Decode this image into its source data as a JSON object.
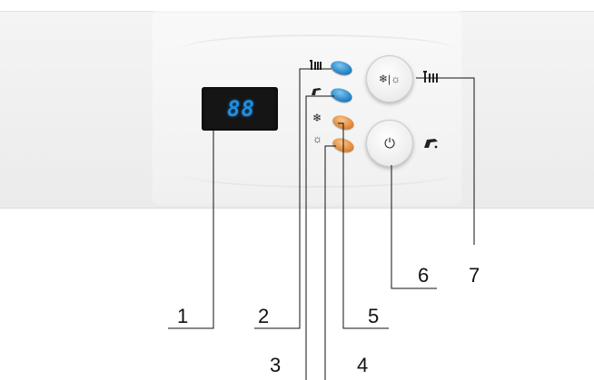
{
  "display": {
    "digits": "88"
  },
  "mode_icons": {
    "heating": "radiator-icon",
    "hot_water": "tap-icon",
    "winter": "snowflake-icon",
    "summer": "sun-icon"
  },
  "leds": [
    {
      "name": "heating-led",
      "color": "#2a86c8"
    },
    {
      "name": "hot-water-led",
      "color": "#2a86c8"
    },
    {
      "name": "winter-led",
      "color": "#e58a3c"
    },
    {
      "name": "summer-led",
      "color": "#e58a3c"
    }
  ],
  "buttons": {
    "mode": {
      "glyph": "❄|☼"
    },
    "power": {
      "glyph": "⏻"
    }
  },
  "callouts": [
    "1",
    "2",
    "3",
    "4",
    "5",
    "6",
    "7"
  ]
}
